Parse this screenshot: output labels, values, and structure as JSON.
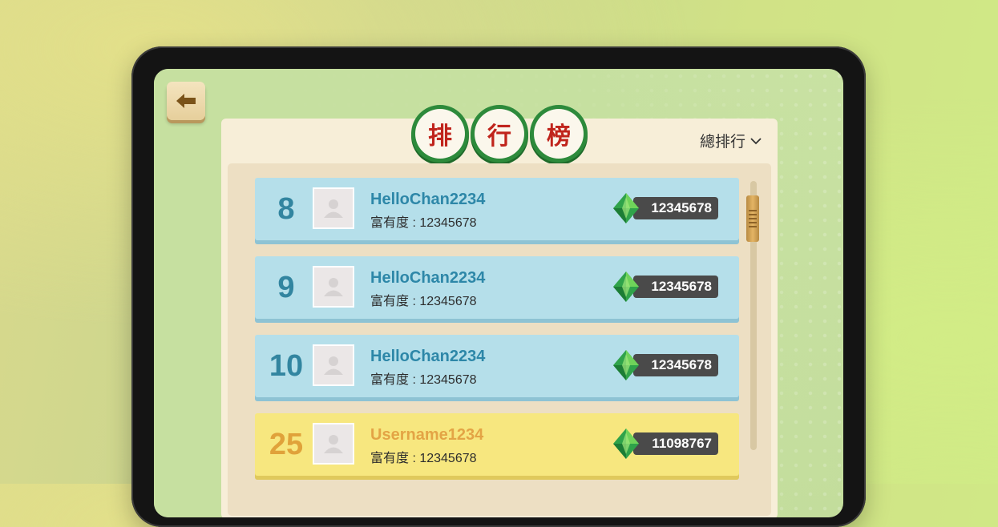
{
  "header": {
    "back_icon": "arrow-left-icon",
    "title_chars": [
      "排",
      "行",
      "榜"
    ],
    "sort_label": "總排行",
    "sort_icon": "chevron-down-icon"
  },
  "colors": {
    "accent_green": "#2d8a3b",
    "title_red": "#c0241c",
    "row_blue": "#b5dfea",
    "row_highlight": "#f7e77f"
  },
  "leaderboard": {
    "rows": [
      {
        "rank": "8",
        "name": "HelloChan2234",
        "wealth": "富有度 : 12345678",
        "score": "12345678",
        "style": "blue"
      },
      {
        "rank": "9",
        "name": "HelloChan2234",
        "wealth": "富有度 : 12345678",
        "score": "12345678",
        "style": "blue"
      },
      {
        "rank": "10",
        "name": "HelloChan2234",
        "wealth": "富有度 : 12345678",
        "score": "12345678",
        "style": "blue"
      },
      {
        "rank": "25",
        "name": "Username1234",
        "wealth": "富有度 : 12345678",
        "score": "11098767",
        "style": "yellow"
      }
    ]
  }
}
